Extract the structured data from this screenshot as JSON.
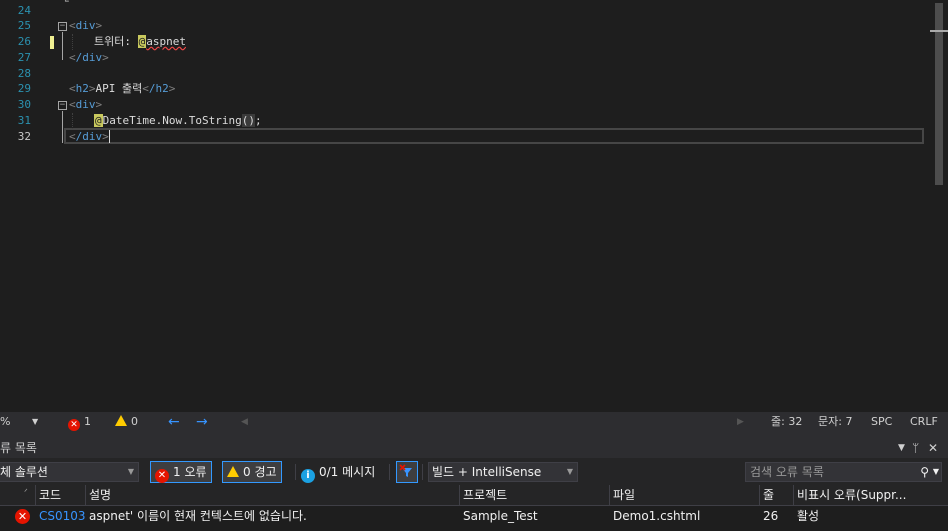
{
  "editor": {
    "lines": [
      {
        "num": "24"
      },
      {
        "num": "25",
        "tag": "div"
      },
      {
        "num": "26",
        "label": "트위터: ",
        "razor": "@",
        "ident": "aspnet"
      },
      {
        "num": "27",
        "tag": "/div"
      },
      {
        "num": "28"
      },
      {
        "num": "29",
        "h2_open": "h2",
        "h2_text": "API 출력",
        "h2_close": "/h2"
      },
      {
        "num": "30",
        "tag": "div"
      },
      {
        "num": "31",
        "razor": "@",
        "expr": "DateTime.Now.ToString",
        "paren_open": "(",
        "paren_close": ")",
        "semi": ";"
      },
      {
        "num": "32",
        "tag": "/div"
      }
    ]
  },
  "editor_status": {
    "zoom": "%",
    "errors": "1",
    "warnings": "0",
    "line": "줄: 32",
    "col": "문자: 7",
    "spc": "SPC",
    "crlf": "CRLF"
  },
  "error_list": {
    "title": "류 목록",
    "scope": "체 솔루션",
    "errors_btn": "1 오류",
    "warnings_btn": "0 경고",
    "messages": "0/1 메시지",
    "build_filter": "빌드 + IntelliSense",
    "search_placeholder": "검색 오류 목록",
    "columns": [
      "코드",
      "설명",
      "프로젝트",
      "파일",
      "줄",
      "비표시 오류(Suppr..."
    ],
    "rows": [
      {
        "code": "CS0103",
        "description": "aspnet' 이름이 현재 컨텍스트에 없습니다.",
        "project": "Sample_Test",
        "file": "Demo1.cshtml",
        "line": "26",
        "suppression": "활성"
      }
    ]
  },
  "colors": {
    "editor_bg": "#1e1e1e",
    "line_number": "#2b91af",
    "tag_name": "#569cd6",
    "razor_highlight": "#c9c95e",
    "error": "#e51400",
    "accent": "#3399ff"
  }
}
